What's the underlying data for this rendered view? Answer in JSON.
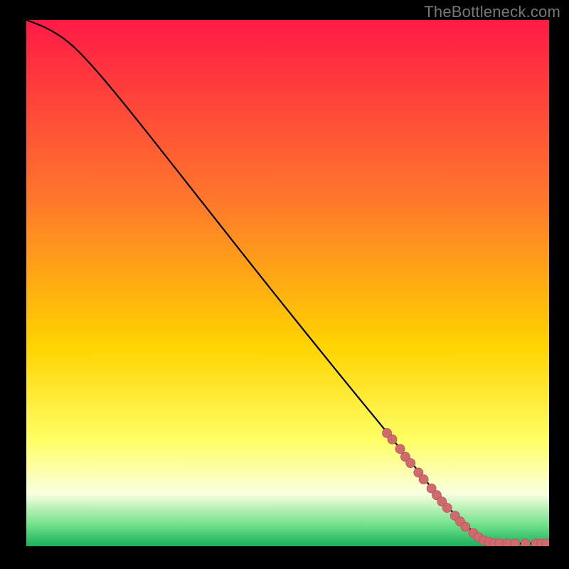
{
  "watermark": "TheBottleneck.com",
  "colors": {
    "bg": "#000000",
    "curve": "#000000",
    "marker_fill": "#cf6a6f",
    "marker_stroke": "#b85257",
    "grad_top": "#ff1a46",
    "grad_mid_upper": "#ff7a2a",
    "grad_mid": "#ffd400",
    "grad_sweet_top": "#ffff66",
    "grad_sweet_mid": "#faffe0",
    "grad_sweet_bottom": "#6fe08a",
    "grad_bottom": "#18b05a"
  },
  "chart_data": {
    "type": "line",
    "xlim": [
      0,
      100
    ],
    "ylim": [
      0,
      100
    ],
    "xlabel": "",
    "ylabel": "",
    "title": "",
    "curve": [
      {
        "x": 0,
        "y": 100
      },
      {
        "x": 4,
        "y": 98.5
      },
      {
        "x": 8,
        "y": 96
      },
      {
        "x": 12,
        "y": 92
      },
      {
        "x": 18,
        "y": 85
      },
      {
        "x": 30,
        "y": 70
      },
      {
        "x": 45,
        "y": 51
      },
      {
        "x": 60,
        "y": 32.5
      },
      {
        "x": 72,
        "y": 18
      },
      {
        "x": 80,
        "y": 8
      },
      {
        "x": 85,
        "y": 3
      },
      {
        "x": 88,
        "y": 1
      },
      {
        "x": 92,
        "y": 0.5
      },
      {
        "x": 100,
        "y": 0.5
      }
    ],
    "markers": [
      {
        "x": 69,
        "y": 21.5
      },
      {
        "x": 70,
        "y": 20.3
      },
      {
        "x": 71.5,
        "y": 18.5
      },
      {
        "x": 72.5,
        "y": 17
      },
      {
        "x": 73.5,
        "y": 15.8
      },
      {
        "x": 75,
        "y": 14
      },
      {
        "x": 76,
        "y": 12.7
      },
      {
        "x": 77.5,
        "y": 11
      },
      {
        "x": 78.5,
        "y": 9.7
      },
      {
        "x": 79.5,
        "y": 8.5
      },
      {
        "x": 80.5,
        "y": 7.3
      },
      {
        "x": 82,
        "y": 5.8
      },
      {
        "x": 83,
        "y": 4.7
      },
      {
        "x": 84,
        "y": 3.7
      },
      {
        "x": 85.5,
        "y": 2.5
      },
      {
        "x": 86.5,
        "y": 1.7
      },
      {
        "x": 87.5,
        "y": 1.1
      },
      {
        "x": 88.5,
        "y": 0.8
      },
      {
        "x": 89.5,
        "y": 0.6
      },
      {
        "x": 90.5,
        "y": 0.55
      },
      {
        "x": 92,
        "y": 0.5
      },
      {
        "x": 93.5,
        "y": 0.5
      },
      {
        "x": 95.5,
        "y": 0.5
      },
      {
        "x": 97.5,
        "y": 0.5
      },
      {
        "x": 98.5,
        "y": 0.5
      },
      {
        "x": 99.5,
        "y": 0.5
      }
    ]
  }
}
